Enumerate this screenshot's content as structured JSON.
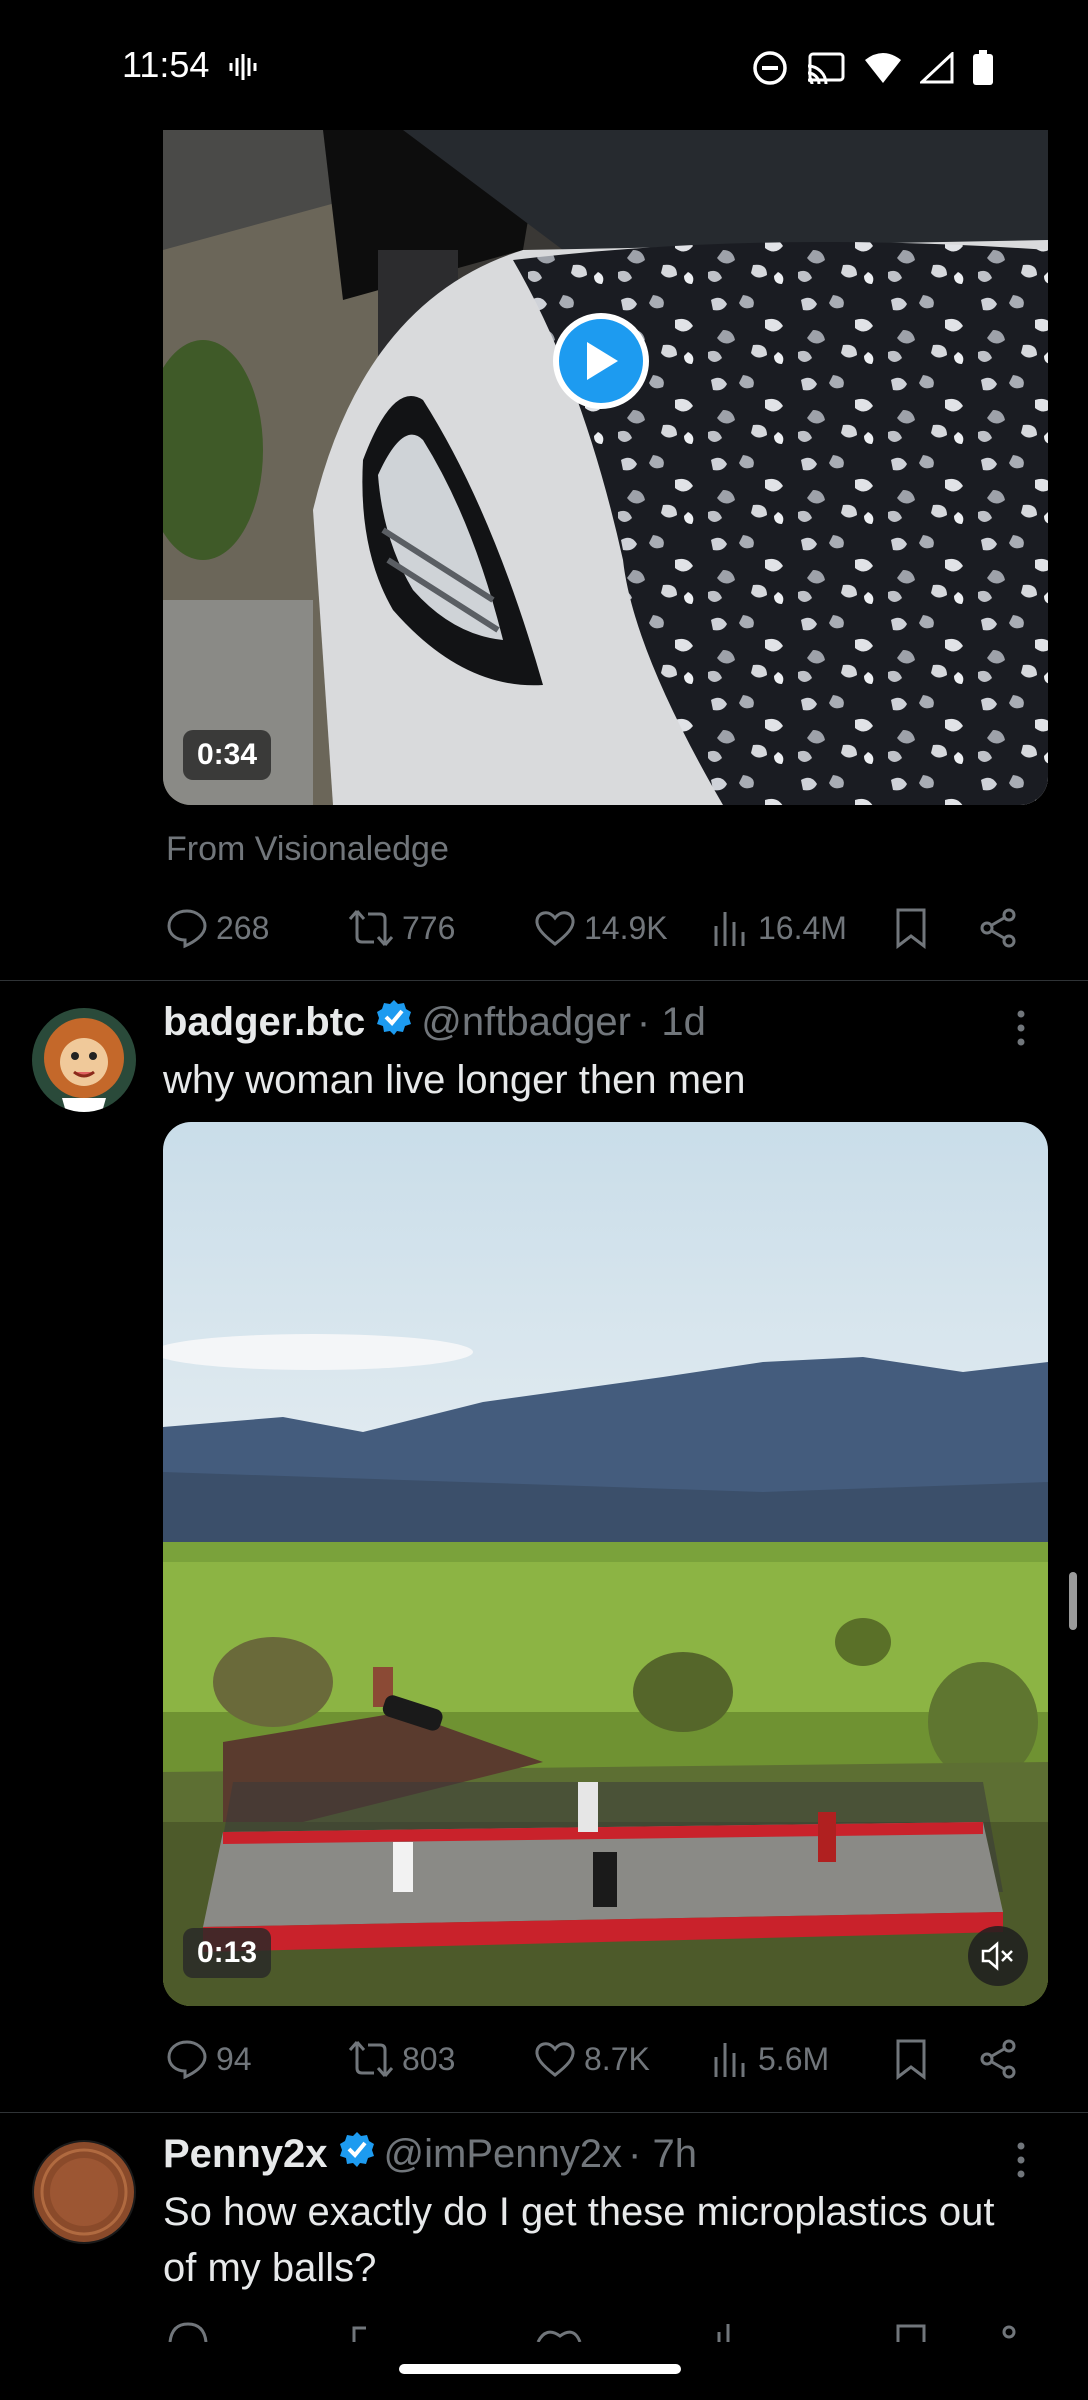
{
  "status_bar": {
    "time": "11:54",
    "icons": [
      "vibrate-icon",
      "do-not-disturb-icon",
      "cast-icon",
      "wifi-icon",
      "signal-icon",
      "battery-icon"
    ]
  },
  "tweet_top": {
    "video_duration": "0:34",
    "source_label": "From Visionaledge",
    "stats": {
      "replies": "268",
      "reposts": "776",
      "likes": "14.9K",
      "views": "16.4M"
    }
  },
  "tweet_badger": {
    "display_name": "badger.btc",
    "handle": "@nftbadger",
    "time": "· 1d",
    "text": "why woman live longer then men",
    "video_duration": "0:13",
    "stats": {
      "replies": "94",
      "reposts": "803",
      "likes": "8.7K",
      "views": "5.6M"
    }
  },
  "tweet_penny": {
    "display_name": "Penny2x",
    "handle": "@imPenny2x",
    "time": "· 7h",
    "text": "So how exactly do I get these microplastics out of my balls?"
  },
  "colors": {
    "accent": "#1d9bf0",
    "background": "#000000",
    "muted": "#71767b",
    "text": "#e7e9ea"
  }
}
